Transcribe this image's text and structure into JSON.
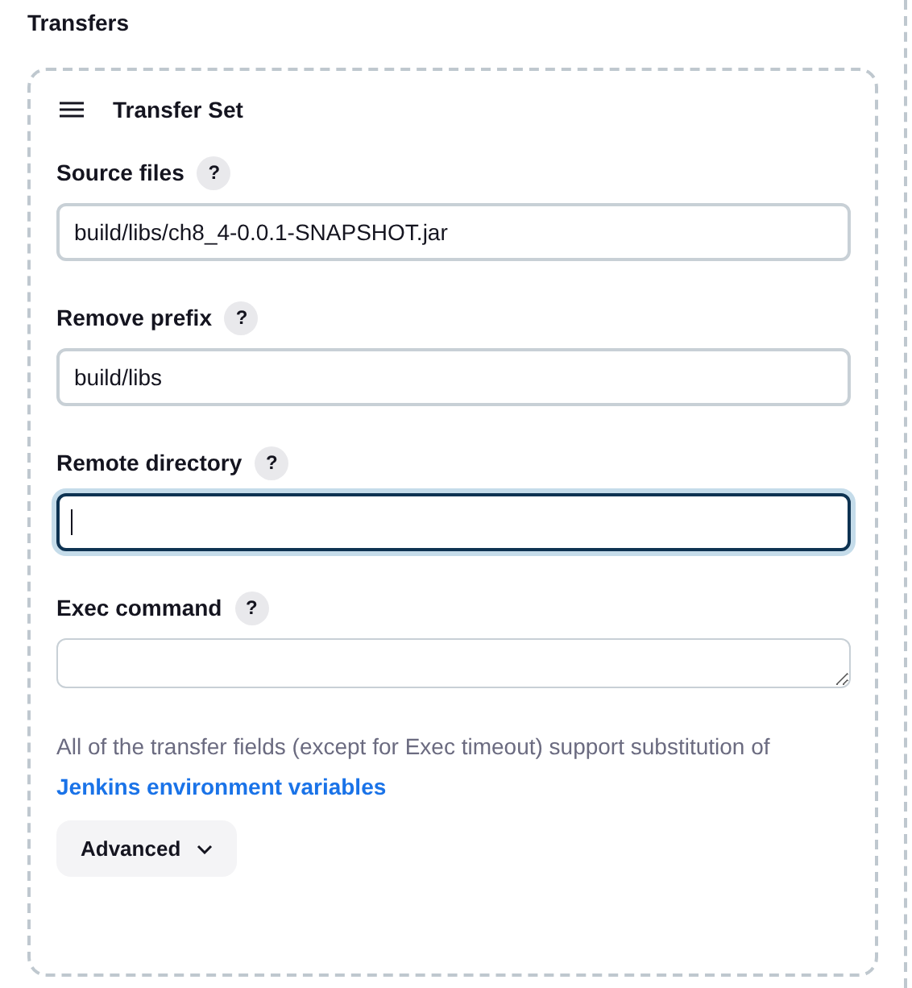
{
  "section_title": "Transfers",
  "transfer_set": {
    "title": "Transfer Set",
    "fields": [
      {
        "label": "Source files",
        "help": "?",
        "kind": "text",
        "value": "build/libs/ch8_4-0.0.1-SNAPSHOT.jar",
        "focused": false
      },
      {
        "label": "Remove prefix",
        "help": "?",
        "kind": "text",
        "value": "build/libs",
        "focused": false
      },
      {
        "label": "Remote directory",
        "help": "?",
        "kind": "text",
        "focused": true
      },
      {
        "label": "Exec command",
        "help": "?",
        "kind": "textarea",
        "focused": false
      }
    ],
    "note": "All of the transfer fields (except for Exec timeout) support substitution of",
    "note_link": "Jenkins environment variables",
    "advanced_button": {
      "label": "Advanced",
      "expanded": false
    }
  }
}
